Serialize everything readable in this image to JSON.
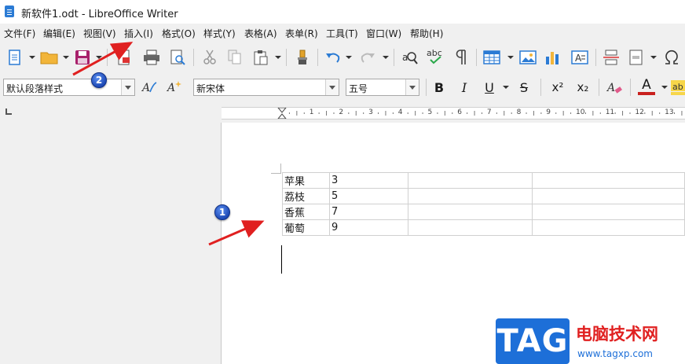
{
  "window": {
    "title": "新软件1.odt - LibreOffice Writer"
  },
  "menu": [
    "文件(F)",
    "编辑(E)",
    "视图(V)",
    "插入(I)",
    "格式(O)",
    "样式(Y)",
    "表格(A)",
    "表单(R)",
    "工具(T)",
    "窗口(W)",
    "帮助(H)"
  ],
  "toolbar2": {
    "paragraph_style": "默认段落样式",
    "font_name": "新宋体",
    "font_size": "五号",
    "bold": "B",
    "italic": "I",
    "underline": "U",
    "strike": "S",
    "superscript": "x²",
    "subscript": "x₂",
    "font_color": "A"
  },
  "ruler": {
    "numbers": [
      "1",
      "2",
      "3",
      "4",
      "5",
      "6",
      "7",
      "8",
      "9",
      "10",
      "11",
      "12",
      "13"
    ]
  },
  "table": {
    "rows": [
      [
        "苹果",
        "3",
        "",
        ""
      ],
      [
        "荔枝",
        "5",
        "",
        ""
      ],
      [
        "香蕉",
        "7",
        "",
        ""
      ],
      [
        "葡萄",
        "9",
        "",
        ""
      ]
    ]
  },
  "annotations": {
    "badge1": "1",
    "badge2": "2",
    "arrow_color": "#e02020",
    "badge_color": "#1d49b5"
  },
  "watermark": {
    "tag": "TAG",
    "name": "电脑技术网",
    "url": "www.tagxp.com"
  }
}
